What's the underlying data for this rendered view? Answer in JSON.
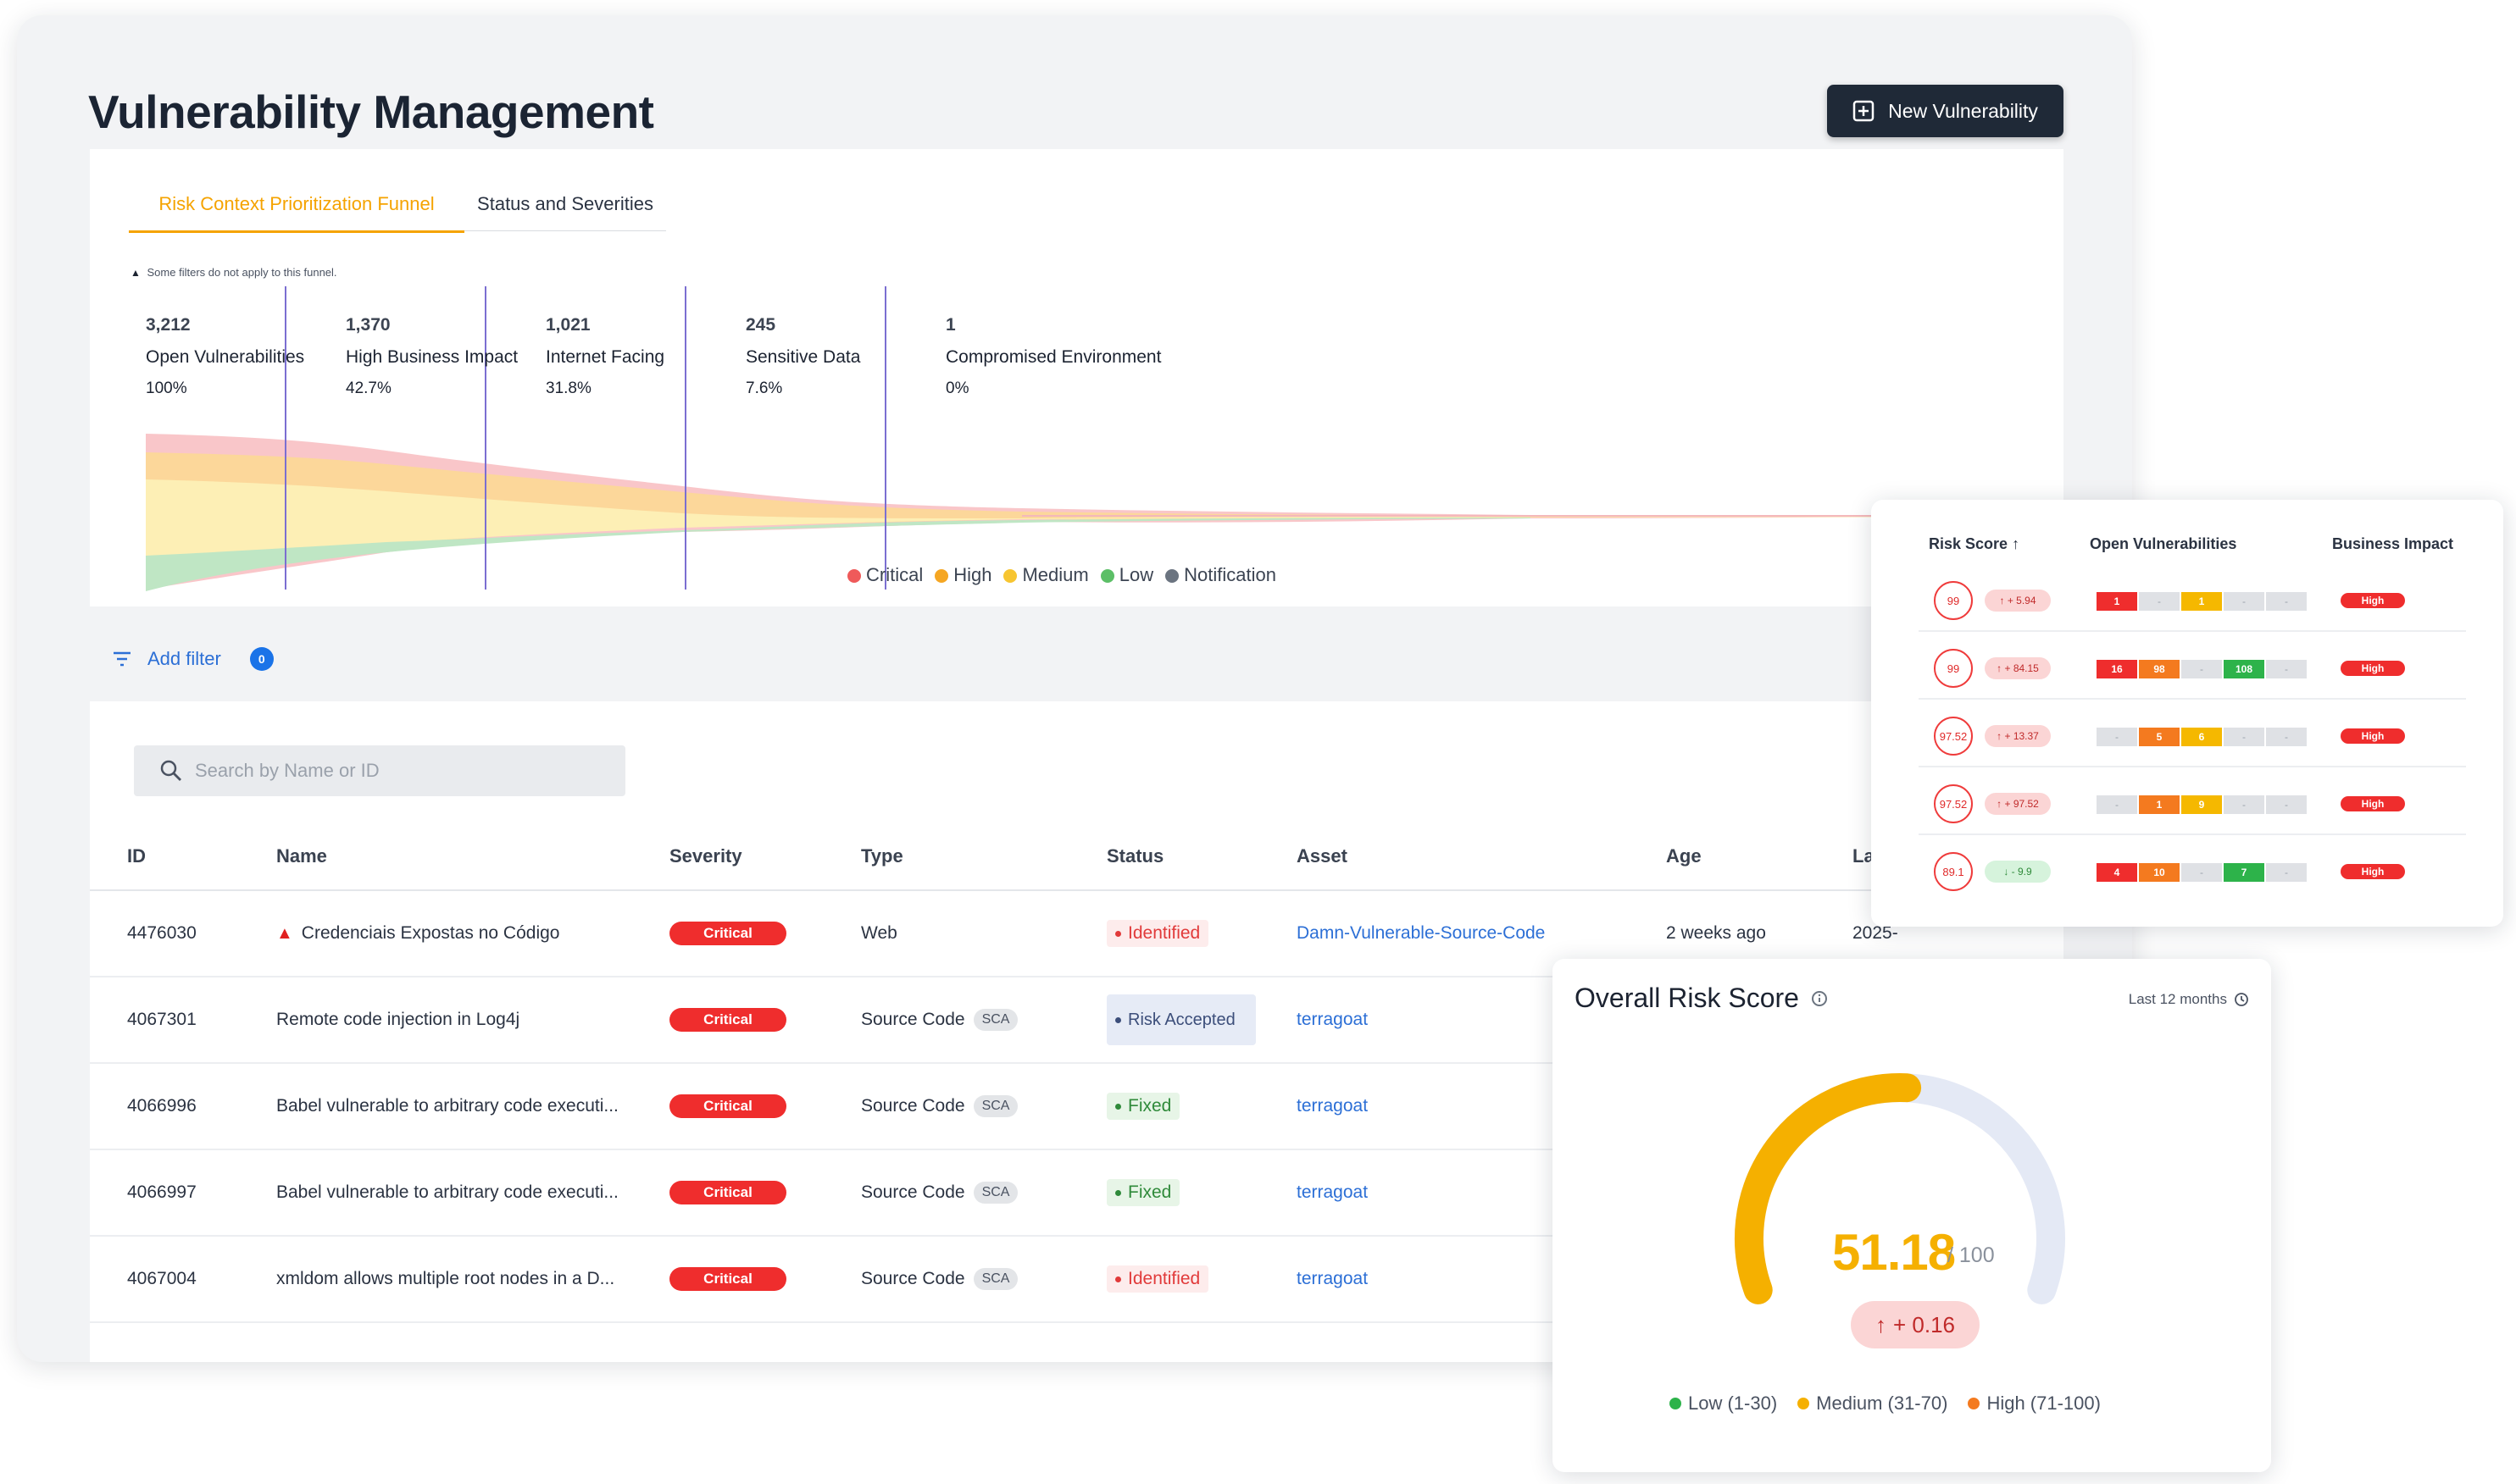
{
  "page": {
    "title": "Vulnerability Management",
    "new_button": "New Vulnerability"
  },
  "funnel": {
    "tabs": [
      "Risk Context Prioritization Funnel",
      "Status and Severities"
    ],
    "note": "Some filters do not apply to this funnel.",
    "stages": [
      {
        "count": "3,212",
        "label": "Open Vulnerabilities",
        "pct": "100%"
      },
      {
        "count": "1,370",
        "label": "High Business Impact",
        "pct": "42.7%"
      },
      {
        "count": "1,021",
        "label": "Internet Facing",
        "pct": "31.8%"
      },
      {
        "count": "245",
        "label": "Sensitive Data",
        "pct": "7.6%"
      },
      {
        "count": "1",
        "label": "Compromised Environment",
        "pct": "0%"
      }
    ],
    "legend": [
      {
        "name": "Critical",
        "color": "#ef5a5a"
      },
      {
        "name": "High",
        "color": "#f5a623"
      },
      {
        "name": "Medium",
        "color": "#f7c531"
      },
      {
        "name": "Low",
        "color": "#5cbf67"
      },
      {
        "name": "Notification",
        "color": "#6b7480"
      }
    ]
  },
  "filters": {
    "add_label": "Add filter",
    "count": "0"
  },
  "table": {
    "search_placeholder": "Search by Name or ID",
    "columns": [
      "ID",
      "Name",
      "Severity",
      "Type",
      "Status",
      "Asset",
      "Age",
      "Last"
    ],
    "rows": [
      {
        "id": "4476030",
        "name": "Credenciais Expostas no Código",
        "severity": "Critical",
        "type": "Web",
        "sca": "",
        "status": "Identified",
        "asset": "Damn-Vulnerable-Source-Code",
        "age": "2 weeks ago",
        "last": "2025-"
      },
      {
        "id": "4067301",
        "name": "Remote code injection in Log4j",
        "severity": "Critical",
        "type": "Source Code",
        "sca": "SCA",
        "status": "Risk Accepted",
        "asset": "terragoat",
        "age": "",
        "last": ""
      },
      {
        "id": "4066996",
        "name": "Babel vulnerable to arbitrary code executi...",
        "severity": "Critical",
        "type": "Source Code",
        "sca": "SCA",
        "status": "Fixed",
        "asset": "terragoat",
        "age": "",
        "last": ""
      },
      {
        "id": "4066997",
        "name": "Babel vulnerable to arbitrary code executi...",
        "severity": "Critical",
        "type": "Source Code",
        "sca": "SCA",
        "status": "Fixed",
        "asset": "terragoat",
        "age": "",
        "last": ""
      },
      {
        "id": "4067004",
        "name": "xmldom allows multiple root nodes in a D...",
        "severity": "Critical",
        "type": "Source Code",
        "sca": "SCA",
        "status": "Identified",
        "asset": "terragoat",
        "age": "",
        "last": ""
      }
    ]
  },
  "risk_card": {
    "columns": [
      "Risk Score",
      "Open Vulnerabilities",
      "Business Impact"
    ],
    "rows": [
      {
        "score": "99",
        "delta": "+ 5.94",
        "dir": "up",
        "segments": [
          "1",
          "-",
          "1",
          "-",
          "-"
        ],
        "impact": "High"
      },
      {
        "score": "99",
        "delta": "+ 84.15",
        "dir": "up",
        "segments": [
          "16",
          "98",
          "-",
          "108",
          "-"
        ],
        "impact": "High"
      },
      {
        "score": "97.52",
        "delta": "+ 13.37",
        "dir": "up",
        "segments": [
          "-",
          "5",
          "6",
          "-",
          "-"
        ],
        "impact": "High"
      },
      {
        "score": "97.52",
        "delta": "+ 97.52",
        "dir": "up",
        "segments": [
          "-",
          "1",
          "9",
          "-",
          "-"
        ],
        "impact": "High"
      },
      {
        "score": "89.1",
        "delta": "- 9.9",
        "dir": "down",
        "segments": [
          "4",
          "10",
          "-",
          "7",
          "-"
        ],
        "impact": "High"
      }
    ]
  },
  "overall": {
    "title": "Overall Risk Score",
    "period": "Last 12 months",
    "score": "51.18",
    "score_fraction": 0.5118,
    "max": "/ 100",
    "delta": "+ 0.16",
    "legend": [
      {
        "name": "Low (1-30)",
        "color": "#2db34a"
      },
      {
        "name": "Medium (31-70)",
        "color": "#f5b000"
      },
      {
        "name": "High (71-100)",
        "color": "#f47a1f"
      }
    ]
  }
}
